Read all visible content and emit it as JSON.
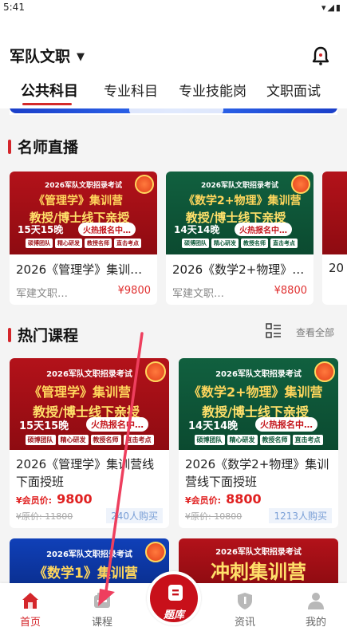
{
  "status": {
    "time": "5:41",
    "icons": "▾◢▮"
  },
  "header": {
    "title": "军队文职",
    "tabs": [
      "公共科目",
      "专业科目",
      "专业技能岗",
      "文职面试"
    ]
  },
  "sections": {
    "live": "名师直播",
    "hot": "热门课程",
    "view_all": "查看全部"
  },
  "poster": {
    "exam": "2026军队文职招录考试",
    "teach": "教授/博士线下亲授",
    "enroll": "火热报名中…",
    "tags": [
      "硕博团队",
      "精心研发",
      "教授名师",
      "直击考点"
    ],
    "sprint": "冲刺集训营"
  },
  "live_courses": [
    {
      "poster_subject": "《管理学》集训营",
      "days": "15天15晚",
      "name": "2026《管理学》集训…",
      "provider": "军建文职…",
      "price": "¥9800"
    },
    {
      "poster_subject": "《数学2+物理》集训营",
      "days": "14天14晚",
      "name": "2026《数学2+物理》…",
      "provider": "军建文职…",
      "price": "¥8800"
    }
  ],
  "live_peek": {
    "name": "20"
  },
  "hot_courses": [
    {
      "poster_subject": "《管理学》集训营",
      "days": "15天15晚",
      "name": "2026《管理学》集训营线下面授班",
      "member_label": "¥会员价:",
      "member_price": "9800",
      "orig_price": "¥原价: 11800",
      "buyers": "240人购买"
    },
    {
      "poster_subject": "《数学2+物理》集训营",
      "days": "14天14晚",
      "name": "2026《数学2+物理》集训营线下面授班",
      "member_label": "¥会员价:",
      "member_price": "8800",
      "orig_price": "¥原价: 10800",
      "buyers": "1213人购买"
    }
  ],
  "more_courses": [
    {
      "poster_subject": "《数学1》集训营"
    },
    {
      "poster_subject": "冲刺集训营"
    }
  ],
  "bottom_nav": [
    {
      "label": "首页",
      "icon": "home-icon",
      "active": true
    },
    {
      "label": "课程",
      "icon": "course-icon",
      "active": false
    },
    {
      "label": "题库",
      "icon": "question-bank-icon",
      "active": false
    },
    {
      "label": "资讯",
      "icon": "news-icon",
      "active": false
    },
    {
      "label": "我的",
      "icon": "profile-icon",
      "active": false
    }
  ],
  "colors": {
    "accent": "#d4262b",
    "red_poster": "#a0151b",
    "green_poster": "#0f5b3b",
    "blue_poster": "#1040b8",
    "arrow": "#ee3f5e"
  }
}
